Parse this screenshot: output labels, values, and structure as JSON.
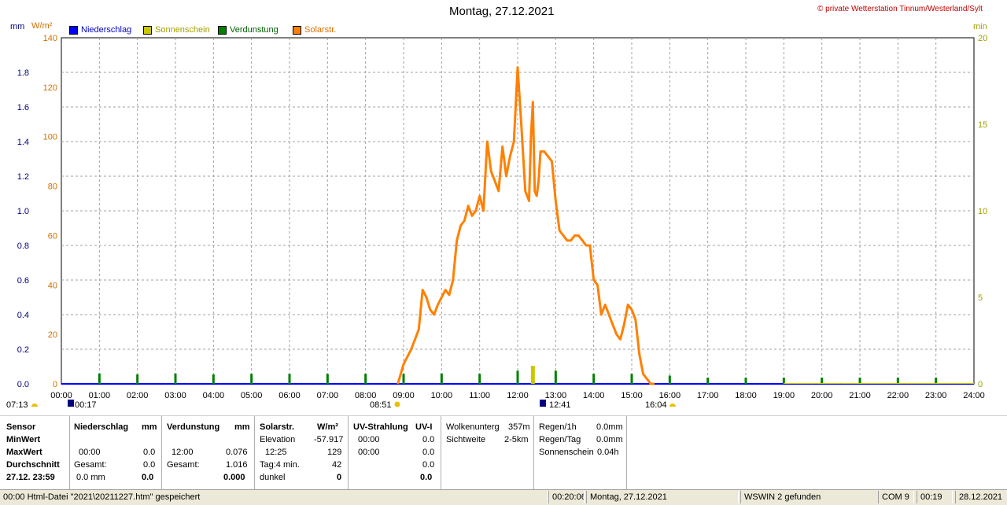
{
  "header": {
    "title": "Montag, 27.12.2021",
    "credit": "© private Wetterstation Tinnum/Westerland/Sylt"
  },
  "units": {
    "left_mm": "mm",
    "left_wm2": "W/m²",
    "right_min": "min"
  },
  "colors": {
    "niederschlag": "#0000ff",
    "sonnenschein": "#c8c800",
    "verdunstung": "#008000",
    "solar": "#ff8000",
    "axis_mm": "#000080",
    "axis_wm2": "#d07000",
    "axis_min": "#a0a000",
    "credit": "#c00000",
    "grid": "#a0a0a0"
  },
  "time_markers": [
    {
      "label": "07:13",
      "icon": "sunrise-icon"
    },
    {
      "label": "00:17",
      "icon": "moonset-icon"
    },
    {
      "label": "08:51",
      "icon": "sun-icon"
    },
    {
      "label": "12:41",
      "icon": "moonrise-icon"
    },
    {
      "label": "16:04",
      "icon": "sunset-icon"
    }
  ],
  "chart_data": {
    "type": "line",
    "title": "Montag, 27.12.2021",
    "x_unit": "hour",
    "xlim": [
      0,
      24
    ],
    "x_ticks": [
      "00:00",
      "01:00",
      "02:00",
      "03:00",
      "04:00",
      "05:00",
      "06:00",
      "07:00",
      "08:00",
      "09:00",
      "10:00",
      "11:00",
      "12:00",
      "13:00",
      "14:00",
      "15:00",
      "16:00",
      "17:00",
      "18:00",
      "19:00",
      "20:00",
      "21:00",
      "22:00",
      "23:00",
      "24:00"
    ],
    "grid": true,
    "axes": {
      "mm": {
        "side": "left-outer",
        "ylim": [
          0,
          2.0
        ],
        "ticks": [
          "0.0",
          "0.2",
          "0.4",
          "0.6",
          "0.8",
          "1.0",
          "1.2",
          "1.4",
          "1.6",
          "1.8"
        ]
      },
      "wm2": {
        "side": "left-inner",
        "ylim": [
          0,
          140
        ],
        "ticks": [
          "0",
          "20",
          "40",
          "60",
          "80",
          "100",
          "120",
          "140"
        ]
      },
      "min": {
        "side": "right",
        "ylim": [
          0,
          20
        ],
        "ticks": [
          "0",
          "5",
          "10",
          "15",
          "20"
        ]
      }
    },
    "legend": [
      "Niederschlag",
      "Sonnenschein",
      "Verdunstung",
      "Solarstr."
    ],
    "series": [
      {
        "name": "Niederschlag",
        "axis": "mm",
        "x": [
          0,
          24
        ],
        "y": [
          0,
          0
        ]
      },
      {
        "name": "Sonnenschein",
        "axis": "min",
        "type": "bar",
        "x": [
          12.4,
          19.0,
          19.5,
          20,
          20.5,
          21,
          21.5,
          22,
          22.5,
          23,
          23.5
        ],
        "y": [
          1.04,
          0.05,
          0.05,
          0.05,
          0.05,
          0.05,
          0.05,
          0.05,
          0.05,
          0.05,
          0.05
        ]
      },
      {
        "name": "Verdunstung",
        "axis": "mm",
        "type": "bar",
        "x": [
          1,
          2,
          3,
          4,
          5,
          6,
          7,
          8,
          9,
          10,
          11,
          12,
          13,
          14,
          15,
          16,
          17,
          18,
          19,
          20,
          21,
          22,
          23
        ],
        "y": [
          0.06,
          0.055,
          0.06,
          0.055,
          0.058,
          0.058,
          0.058,
          0.058,
          0.058,
          0.06,
          0.058,
          0.076,
          0.076,
          0.058,
          0.058,
          0.048,
          0.036,
          0.036,
          0.036,
          0.036,
          0.036,
          0.036,
          0.036
        ]
      },
      {
        "name": "Solarstr.",
        "axis": "wm2",
        "x": [
          8.85,
          9.0,
          9.2,
          9.4,
          9.5,
          9.6,
          9.7,
          9.8,
          9.9,
          10.0,
          10.1,
          10.2,
          10.3,
          10.4,
          10.5,
          10.6,
          10.7,
          10.8,
          10.9,
          11.0,
          11.1,
          11.2,
          11.3,
          11.4,
          11.5,
          11.6,
          11.7,
          11.8,
          11.9,
          12.0,
          12.1,
          12.2,
          12.3,
          12.35,
          12.4,
          12.45,
          12.5,
          12.55,
          12.6,
          12.7,
          12.8,
          12.9,
          13.0,
          13.1,
          13.2,
          13.3,
          13.4,
          13.5,
          13.6,
          13.7,
          13.8,
          13.9,
          14.0,
          14.1,
          14.2,
          14.3,
          14.4,
          14.5,
          14.6,
          14.7,
          14.8,
          14.9,
          15.0,
          15.1,
          15.2,
          15.3,
          15.4,
          15.5,
          15.6
        ],
        "y": [
          0,
          8,
          14,
          22,
          38,
          35,
          30,
          28,
          32,
          35,
          38,
          36,
          42,
          58,
          64,
          66,
          72,
          68,
          70,
          76,
          70,
          98,
          86,
          82,
          78,
          96,
          84,
          92,
          98,
          128,
          104,
          78,
          74,
          100,
          114,
          78,
          76,
          82,
          94,
          94,
          92,
          90,
          74,
          62,
          60,
          58,
          58,
          60,
          60,
          58,
          56,
          56,
          42,
          40,
          28,
          32,
          28,
          24,
          20,
          18,
          24,
          32,
          30,
          26,
          12,
          4,
          2,
          0,
          0
        ]
      }
    ]
  },
  "table": {
    "row_labels": [
      "Sensor",
      "MinWert",
      "MaxWert",
      "Durchschnitt",
      "27.12. 23:59"
    ],
    "niederschlag": {
      "title": "Niederschlag",
      "unit": "mm",
      "max_time": "00:00",
      "max_val": "0.0",
      "sum_label": "Gesamt:",
      "sum_val": "0.0",
      "avg": "0.0 mm",
      "last": "0.0"
    },
    "verdunstung": {
      "title": "Verdunstung",
      "unit": "mm",
      "max_time": "12:00",
      "max_val": "0.076",
      "sum_label": "Gesamt:",
      "sum_val": "1.016",
      "last": "0.000"
    },
    "solar": {
      "title": "Solarstr.",
      "unit": "W/m²",
      "elev_label": "Elevation",
      "elev_val": "-57.917",
      "max_time": "12:25",
      "max_val": "129",
      "day_label": "Tag:4 min.",
      "day_val": "42",
      "state": "dunkel",
      "last": "0"
    },
    "uv": {
      "title": "UV-Strahlung",
      "unit": "UV-I",
      "min_time": "00:00",
      "min_val": "0.0",
      "max_time": "00:00",
      "max_val": "0.0",
      "avg_val": "0.0",
      "last": "0.0"
    },
    "cloud": {
      "label": "Wolkenunterg",
      "val": "357m",
      "vis_label": "Sichtweite",
      "vis_val": "2-5km"
    },
    "rain": {
      "h_label": "Regen/1h",
      "h_val": "0.0mm",
      "d_label": "Regen/Tag",
      "d_val": "0.0mm",
      "sun_label": "Sonnenschein",
      "sun_val": "0.04h"
    }
  },
  "status": {
    "left": "00:00  Html-Datei  \"2021\\20211227.htm\"  gespeichert",
    "time": "00:20:06",
    "date": "Montag, 27.12.2021",
    "wswin": "WSWIN 2 gefunden",
    "com": "COM 9",
    "clock": "00:19",
    "day": "28.12.2021"
  }
}
